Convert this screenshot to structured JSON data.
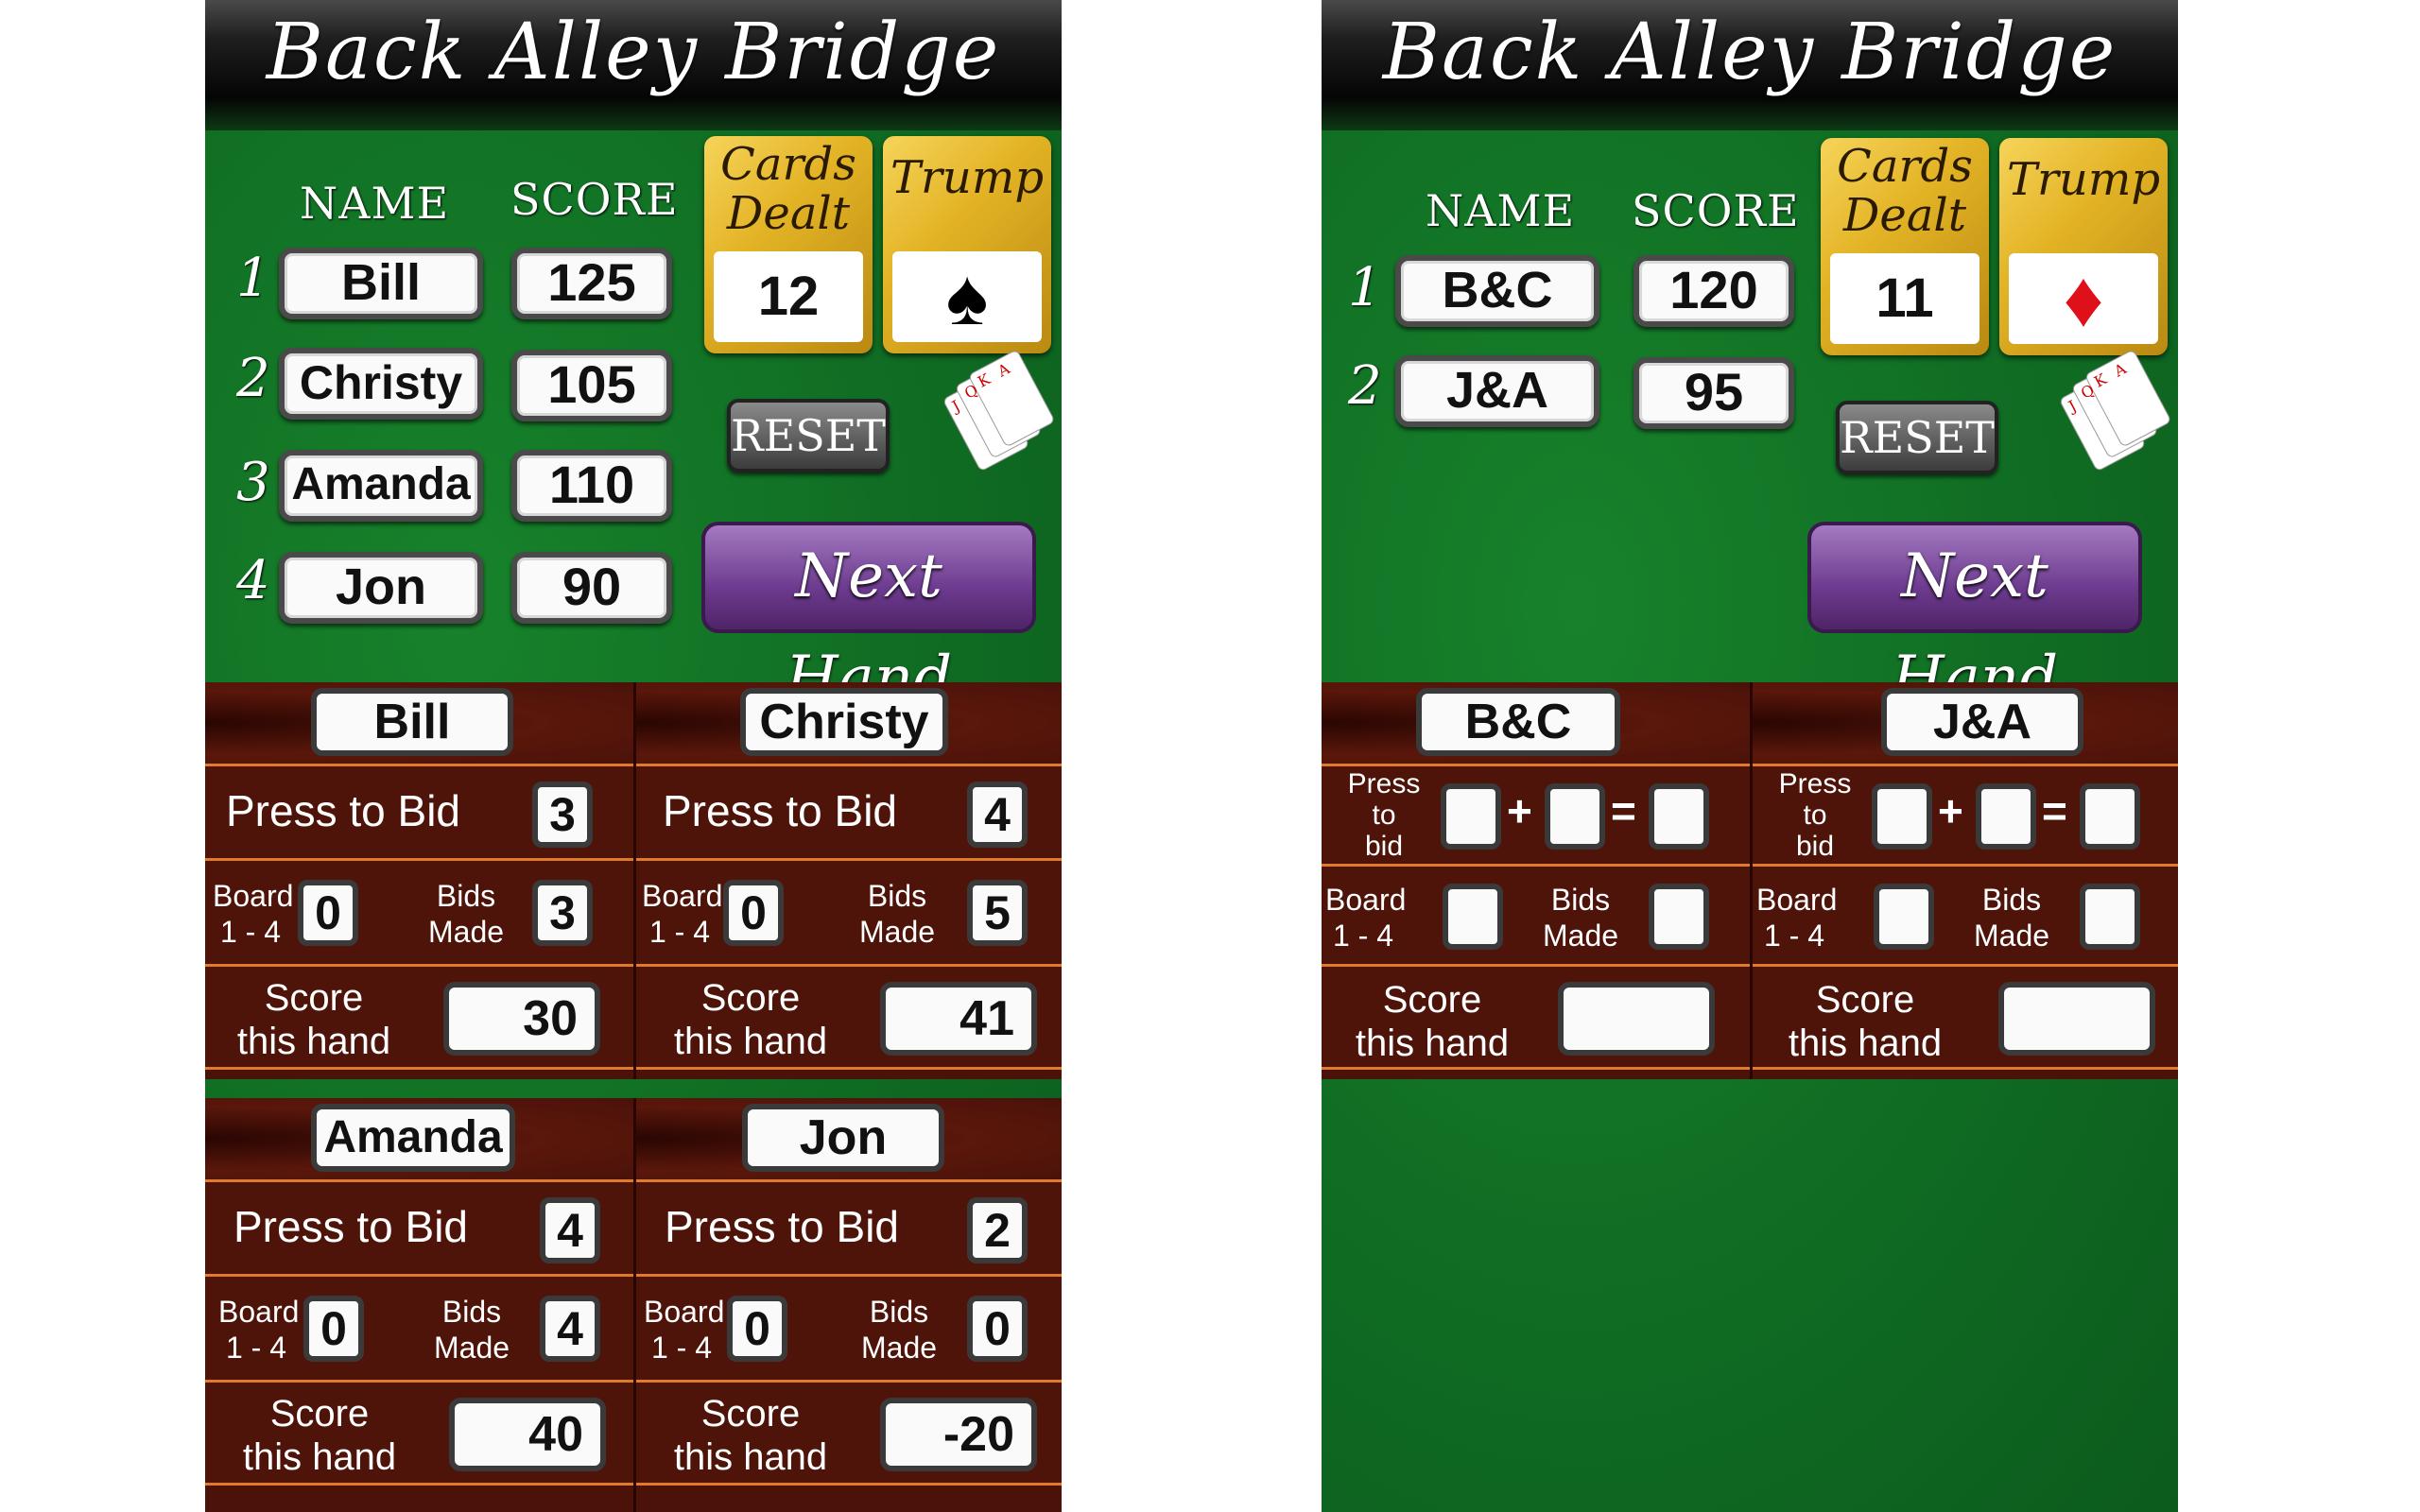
{
  "app_title": "Back Alley Bridge",
  "headers": {
    "name": "NAME",
    "score": "SCORE",
    "cards_dealt": "Cards Dealt",
    "trump": "Trump"
  },
  "buttons": {
    "reset": "RESET",
    "next_hand": "Next Hand"
  },
  "labels": {
    "press_to_bid": "Press to Bid",
    "press_to_bid_stacked": [
      "Press",
      "to",
      "bid"
    ],
    "board": [
      "Board",
      "1 - 4"
    ],
    "bids_made": [
      "Bids",
      "Made"
    ],
    "score_this_hand": [
      "Score",
      "this hand"
    ],
    "plus": "+",
    "equals": "="
  },
  "left_screen": {
    "cards_dealt": "12",
    "trump_suit": "spade",
    "trump_symbol": "♠",
    "players": [
      {
        "rank": "1",
        "name": "Bill",
        "score": "125"
      },
      {
        "rank": "2",
        "name": "Christy",
        "score": "105"
      },
      {
        "rank": "3",
        "name": "Amanda",
        "score": "110"
      },
      {
        "rank": "4",
        "name": "Jon",
        "score": "90"
      }
    ],
    "hands": [
      {
        "name": "Bill",
        "bid": "3",
        "board": "0",
        "bids_made": "3",
        "score_this_hand": "30"
      },
      {
        "name": "Christy",
        "bid": "4",
        "board": "0",
        "bids_made": "5",
        "score_this_hand": "41"
      },
      {
        "name": "Amanda",
        "bid": "4",
        "board": "0",
        "bids_made": "4",
        "score_this_hand": "40"
      },
      {
        "name": "Jon",
        "bid": "2",
        "board": "0",
        "bids_made": "0",
        "score_this_hand": "-20"
      }
    ]
  },
  "right_screen": {
    "cards_dealt": "11",
    "trump_suit": "diamond",
    "trump_symbol": "♦",
    "teams": [
      {
        "rank": "1",
        "name": "B&C",
        "score": "120"
      },
      {
        "rank": "2",
        "name": "J&A",
        "score": "95"
      }
    ],
    "hands": [
      {
        "name": "B&C",
        "bid_a": "",
        "bid_b": "",
        "bid_total": "",
        "board": "",
        "bids_made": "",
        "score_this_hand": ""
      },
      {
        "name": "J&A",
        "bid_a": "",
        "bid_b": "",
        "bid_total": "",
        "board": "",
        "bids_made": "",
        "score_this_hand": ""
      }
    ]
  },
  "colors": {
    "felt": "#0f6a22",
    "wood": "#4a1209",
    "gold": "#e3b325",
    "purple": "#6d3b8f",
    "trump_red": "#e0101a",
    "divider_orange": "#e07a2c"
  }
}
